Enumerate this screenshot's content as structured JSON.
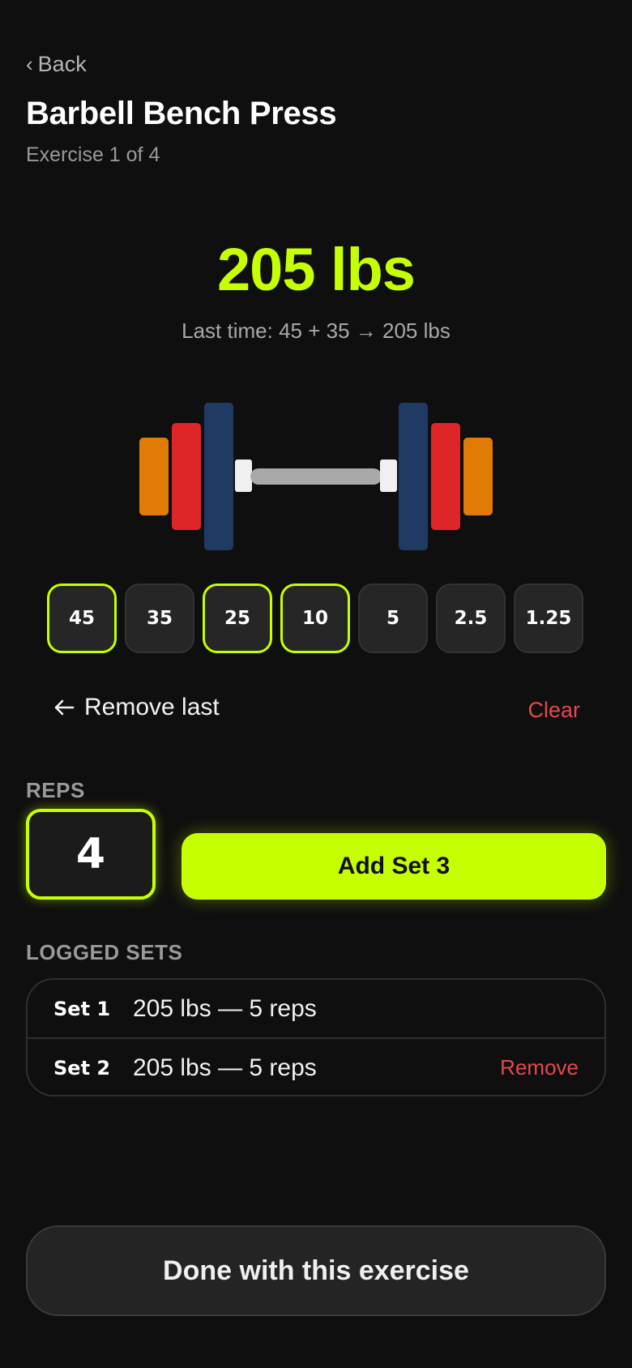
{
  "header": {
    "back_label": "Back",
    "title": "Barbell Bench Press",
    "subtitle": "Exercise 1 of 4"
  },
  "weight": {
    "display": "205 lbs",
    "last_time": "Last time: 45 + 35 → 205 lbs"
  },
  "barbell": {
    "plates_per_side": [
      "45",
      "35",
      "25"
    ],
    "colors": {
      "45": "#1f3a63",
      "35": "#de2628",
      "25": "#e07b06",
      "bar": "#a9a9a9",
      "collar": "#f0f0f0"
    }
  },
  "plate_options": [
    {
      "label": "45",
      "selected": true
    },
    {
      "label": "35",
      "selected": false
    },
    {
      "label": "25",
      "selected": true
    },
    {
      "label": "10",
      "selected": true
    },
    {
      "label": "5",
      "selected": false
    },
    {
      "label": "2.5",
      "selected": false
    },
    {
      "label": "1.25",
      "selected": false
    }
  ],
  "plate_actions": {
    "remove_last_label": "Remove last",
    "clear_label": "Clear"
  },
  "reps": {
    "label": "REPS",
    "value": "4"
  },
  "add_set_label": "Add Set 3",
  "logged": {
    "label": "LOGGED SETS",
    "sets": [
      {
        "name": "Set 1",
        "detail": "205 lbs — 5 reps",
        "action": ""
      },
      {
        "name": "Set 2",
        "detail": "205 lbs — 5 reps",
        "action": "Remove"
      }
    ]
  },
  "done_label": "Done with this exercise",
  "theme": {
    "accent": "#c6ff00",
    "danger": "#e5484d",
    "background": "#0f0f0f"
  }
}
